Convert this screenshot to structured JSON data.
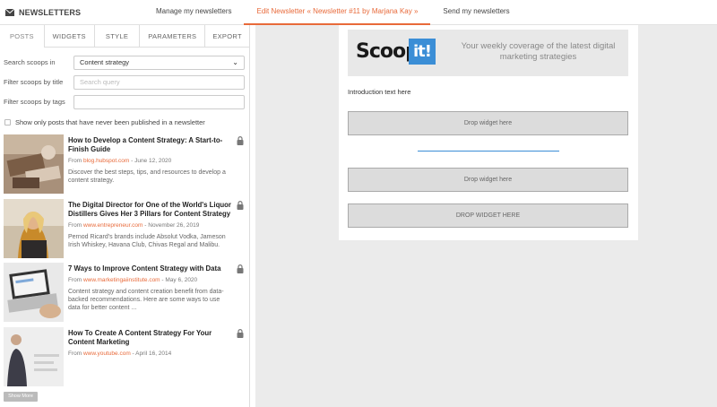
{
  "app": {
    "title": "NEWSLETTERS",
    "icon": "mail-icon"
  },
  "topnav": [
    {
      "label": "Manage my newsletters",
      "active": false
    },
    {
      "label": "Edit Newsletter « Newsletter #11 by Marjana Kay »",
      "active": true
    },
    {
      "label": "Send my newsletters",
      "active": false
    }
  ],
  "tabs": [
    "POSTS",
    "WIDGETS",
    "STYLE",
    "PARAMETERS",
    "EXPORT"
  ],
  "filters": {
    "search_scoops_in": {
      "label": "Search scoops in",
      "value": "Content strategy"
    },
    "by_title": {
      "label": "Filter scoops by title",
      "placeholder": "Search query"
    },
    "by_tags": {
      "label": "Filter scoops by tags",
      "placeholder": ""
    },
    "only_unpublished_label": "Show only posts that have never been published in a newsletter"
  },
  "posts": [
    {
      "title": "How to Develop a Content Strategy: A Start-to-Finish Guide",
      "from": "From",
      "source": "blog.hubspot.com",
      "date": "- June 12, 2020",
      "description": "Discover the best steps, tips, and resources to develop a content strategy."
    },
    {
      "title": "The Digital Director for One of the World's Liquor Distillers Gives Her 3 Pillars for Content Strategy",
      "from": "From",
      "source": "www.entrepreneur.com",
      "date": "- November 26, 2019",
      "description": "Pernod Ricard's brands include Absolut Vodka, Jameson Irish Whiskey, Havana Club, Chivas Regal and Malibu."
    },
    {
      "title": "7 Ways to Improve Content Strategy with Data",
      "from": "From",
      "source": "www.marketingaiinstitute.com",
      "date": "- May 6, 2020",
      "description": "Content strategy and content creation benefit from data-backed recommendations. Here are some ways to use data for better content ..."
    },
    {
      "title": "How To Create A Content Strategy For Your Content Marketing",
      "from": "From",
      "source": "www.youtube.com",
      "date": "- April 16, 2014",
      "description": ""
    }
  ],
  "show_more_label": "Show More",
  "newsletter": {
    "logo_word": "Scoop.",
    "logo_box": "it!",
    "tagline": "Your weekly coverage of the latest digital marketing strategies",
    "intro": "Introduction text here",
    "widgets": [
      "Drop widget here",
      "Drop widget here",
      "DROP WIDGET HERE"
    ]
  },
  "colors": {
    "accent": "#e86a3a",
    "brand_blue": "#3b8ed6"
  }
}
